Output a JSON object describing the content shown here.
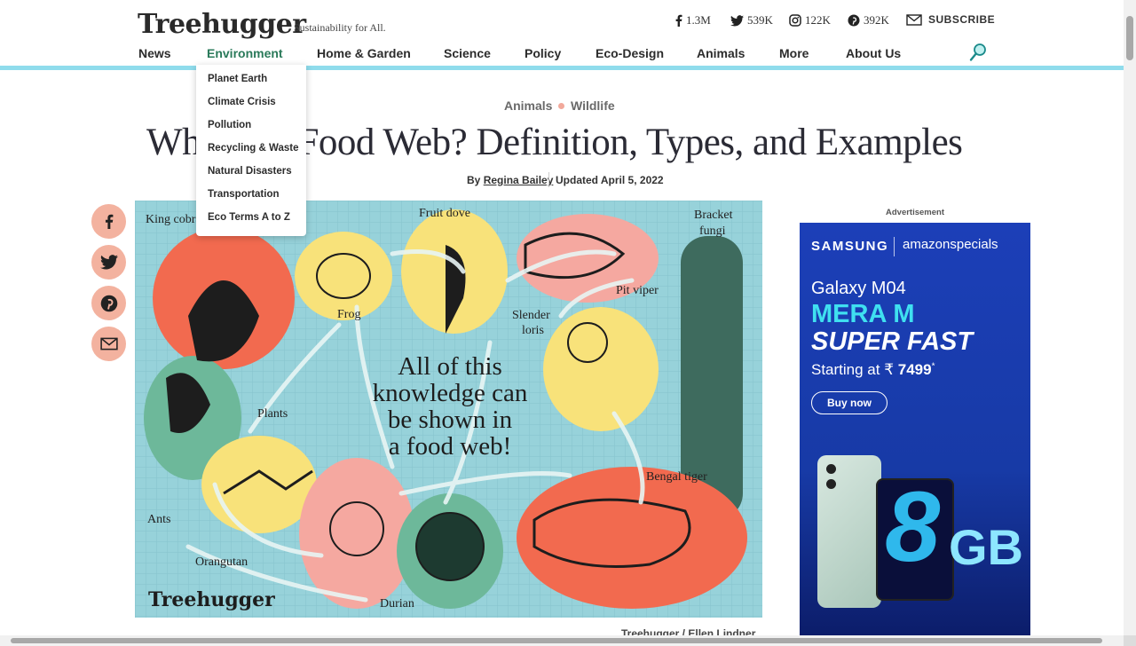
{
  "header": {
    "logo": "Treehugger",
    "tagline": "Sustainability for All.",
    "social": [
      {
        "icon": "facebook-icon",
        "count": "1.3M"
      },
      {
        "icon": "twitter-icon",
        "count": "539K"
      },
      {
        "icon": "instagram-icon",
        "count": "122K"
      },
      {
        "icon": "pinterest-icon",
        "count": "392K"
      }
    ],
    "subscribe_label": "SUBSCRIBE",
    "nav": [
      "News",
      "Environment",
      "Home & Garden",
      "Science",
      "Policy",
      "Eco-Design",
      "Animals",
      "More",
      "About Us"
    ],
    "active_nav": "Environment"
  },
  "dropdown": {
    "items": [
      "Planet Earth",
      "Climate Crisis",
      "Pollution",
      "Recycling & Waste",
      "Natural Disasters",
      "Transportation",
      "Eco Terms A to Z"
    ]
  },
  "article": {
    "breadcrumbs": [
      "Animals",
      "Wildlife"
    ],
    "title": "What Is a Food Web? Definition, Types, and Examples",
    "byline_prefix": "By",
    "author": "Regina Bailey",
    "updated": "Updated April 5, 2022",
    "caption": "Treehugger / Ellen Lindner"
  },
  "share": [
    "facebook-icon",
    "twitter-icon",
    "pinterest-icon",
    "email-icon"
  ],
  "hero": {
    "labels": {
      "king_cobra": "King cobra",
      "frog": "Frog",
      "fruit_dove": "Fruit dove",
      "pit_viper": "Pit viper",
      "bracket_fungi_1": "Bracket",
      "bracket_fungi_2": "fungi",
      "slender_loris_1": "Slender",
      "slender_loris_2": "loris",
      "plants": "Plants",
      "ants": "Ants",
      "orangutan": "Orangutan",
      "durian": "Durian",
      "bengal_tiger": "Bengal tiger"
    },
    "center_text": [
      "All of this",
      "knowledge can",
      "be shown in",
      "a food web!"
    ],
    "watermark": "Treehugger"
  },
  "ad": {
    "label": "Advertisement",
    "brand1": "SAMSUNG",
    "brand2": "amazonspecials",
    "model": "Galaxy M04",
    "line1": "MERA M",
    "line2": "SUPER FAST",
    "price_prefix": "Starting at ₹",
    "price": "7499",
    "price_suffix": "*",
    "cta": "Buy now",
    "ram_number": "8",
    "ram_unit": "GB"
  },
  "colors": {
    "active_nav": "#2a7a5a",
    "accent_bar": "#8fdcec",
    "share_bg": "#f3b29f",
    "hero_bg": "#97d2da",
    "ad_bg": "#1c3fb8"
  }
}
